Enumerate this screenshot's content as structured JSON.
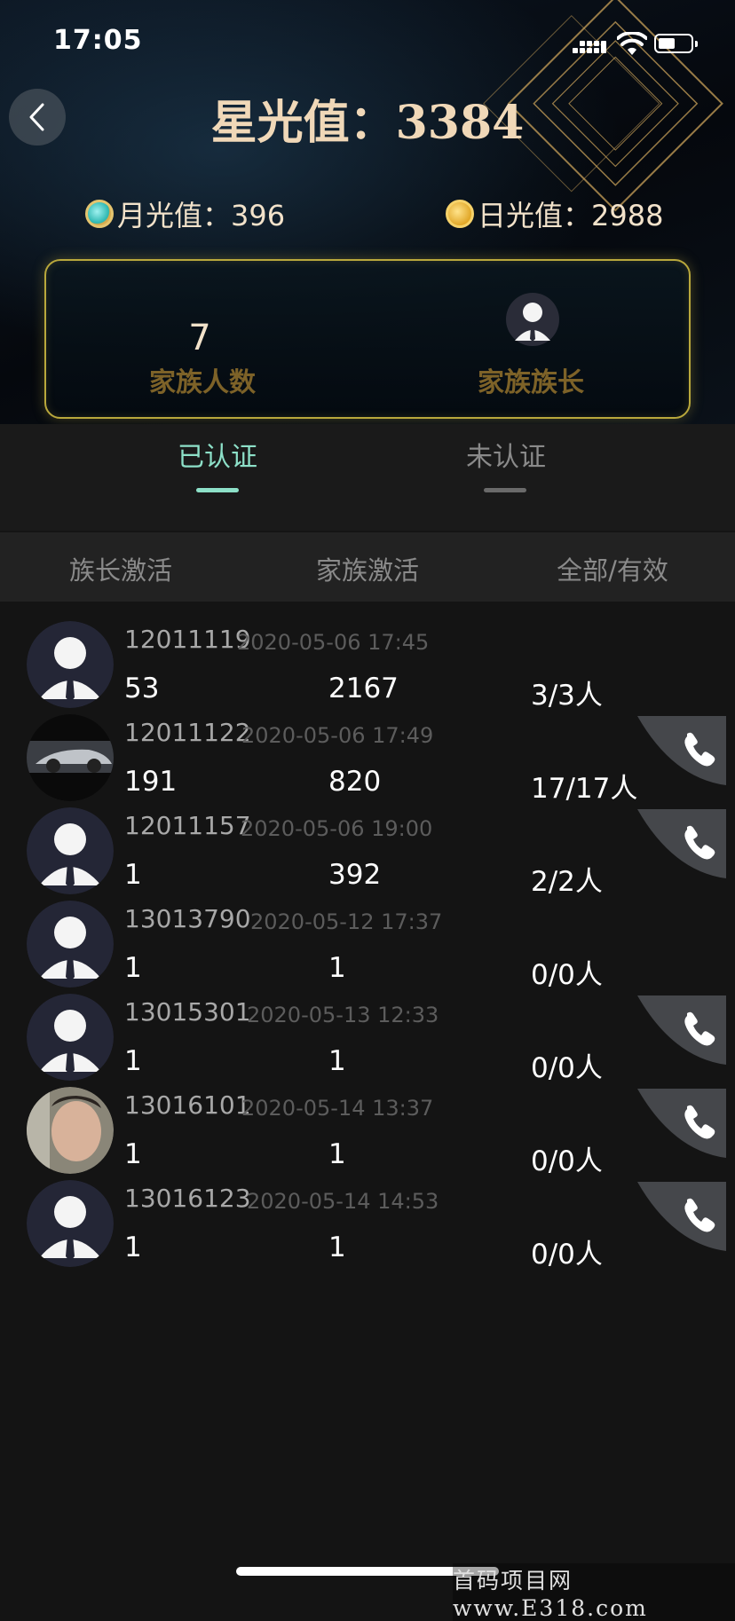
{
  "status_bar": {
    "time": "17:05"
  },
  "header": {
    "title": "星光值：3384",
    "monthly": "月光值：396",
    "daily": "日光值：2988"
  },
  "family": {
    "member_count": "7",
    "member_count_label": "家族人数",
    "leader_label": "家族族长"
  },
  "tabs": [
    {
      "label": "已认证",
      "active": true
    },
    {
      "label": "未认证",
      "active": false
    }
  ],
  "columns": [
    "族长激活",
    "家族激活",
    "全部/有效"
  ],
  "rows": [
    {
      "id": "12011119",
      "date": "2020-05-06 17:45",
      "leader_active": "53",
      "family_active": "2167",
      "total_valid": "3/3人",
      "avatar": "default-avatar",
      "call": false
    },
    {
      "id": "12011122",
      "date": "2020-05-06 17:49",
      "leader_active": "191",
      "family_active": "820",
      "total_valid": "17/17人",
      "avatar": "car-photo-avatar",
      "call": true
    },
    {
      "id": "12011157",
      "date": "2020-05-06 19:00",
      "leader_active": "1",
      "family_active": "392",
      "total_valid": "2/2人",
      "avatar": "default-avatar",
      "call": true
    },
    {
      "id": "13013790",
      "date": "2020-05-12 17:37",
      "leader_active": "1",
      "family_active": "1",
      "total_valid": "0/0人",
      "avatar": "default-avatar",
      "call": false
    },
    {
      "id": "13015301",
      "date": "2020-05-13 12:33",
      "leader_active": "1",
      "family_active": "1",
      "total_valid": "0/0人",
      "avatar": "default-avatar",
      "call": true
    },
    {
      "id": "13016101",
      "date": "2020-05-14 13:37",
      "leader_active": "1",
      "family_active": "1",
      "total_valid": "0/0人",
      "avatar": "face-photo-avatar",
      "call": true
    },
    {
      "id": "13016123",
      "date": "2020-05-14 14:53",
      "leader_active": "1",
      "family_active": "1",
      "total_valid": "0/0人",
      "avatar": "default-avatar",
      "call": true
    }
  ],
  "watermark": "首码项目网 www.E318.com",
  "colors": {
    "accent_tab": "#8de0c8",
    "title_gold": "#f0d8b8",
    "card_border": "#b9a83c",
    "label_gold": "#7d6228"
  }
}
